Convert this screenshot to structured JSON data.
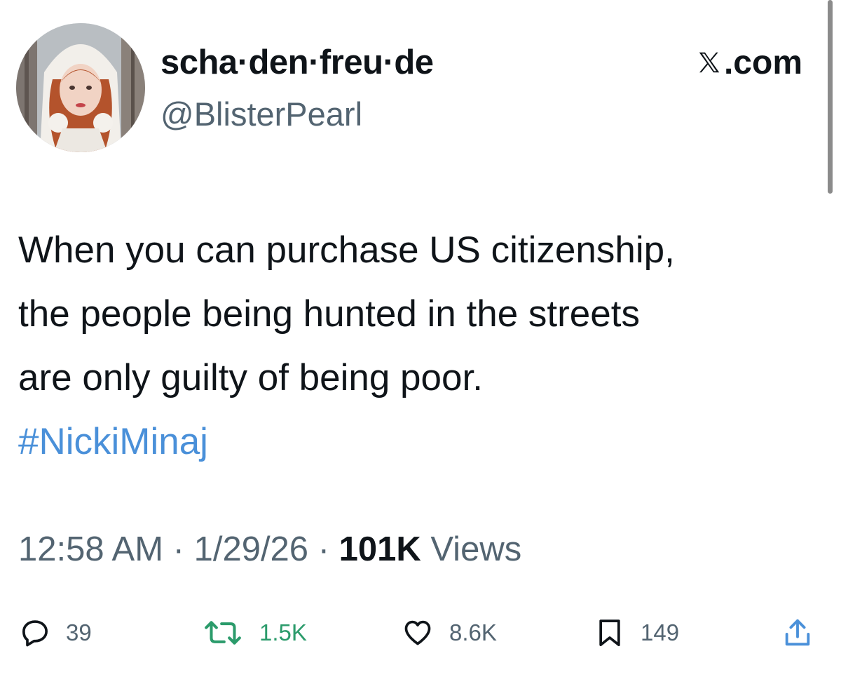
{
  "header": {
    "display_name": "scha·den·freu·de",
    "handle": "@BlisterPearl",
    "brand": ".com",
    "brand_icon": "x-logo-icon"
  },
  "tweet": {
    "lines": [
      "When you can purchase US citizenship,",
      "the people being hunted in the streets",
      "are only guilty of being poor."
    ],
    "hashtag": "#NickiMinaj",
    "hashtag_color": "#4a90d9"
  },
  "meta": {
    "time": "12:58 AM",
    "separator": " · ",
    "date": "1/29/26",
    "views_count": "101K",
    "views_label": " Views"
  },
  "actions": {
    "reply": {
      "icon": "reply-icon",
      "count": "39"
    },
    "retweet": {
      "icon": "retweet-icon",
      "count": "1.5K",
      "color": "#2b9b6b"
    },
    "like": {
      "icon": "heart-icon",
      "count": "8.6K"
    },
    "bookmark": {
      "icon": "bookmark-icon",
      "count": "149"
    },
    "share": {
      "icon": "share-icon"
    }
  }
}
